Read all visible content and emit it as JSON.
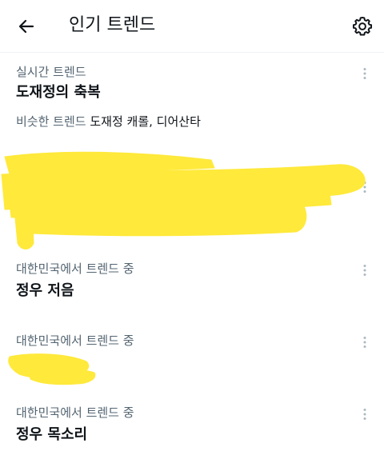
{
  "header": {
    "title": "인기 트렌드",
    "back_icon": "arrow-left-icon",
    "settings_icon": "gear-icon"
  },
  "trends": [
    {
      "meta": "실시간 트렌드",
      "name": "도재정의 축복",
      "related_label": "비슷한 트렌드",
      "related_terms": "도재정 캐롤, 디어산타"
    },
    {
      "meta": "",
      "name": "",
      "redacted": true
    },
    {
      "meta": "대한민국에서 트렌드 중",
      "name": "정우 저음"
    },
    {
      "meta": "대한민국에서 트렌드 중",
      "name": "",
      "redacted": true
    },
    {
      "meta": "대한민국에서 트렌드 중",
      "name": "정우 목소리"
    }
  ],
  "colors": {
    "text_primary": "#0f1419",
    "text_secondary": "#536471",
    "redaction_highlight": "#ffe93b",
    "divider": "#eff3f4"
  },
  "more_icon": "more-vertical-icon"
}
